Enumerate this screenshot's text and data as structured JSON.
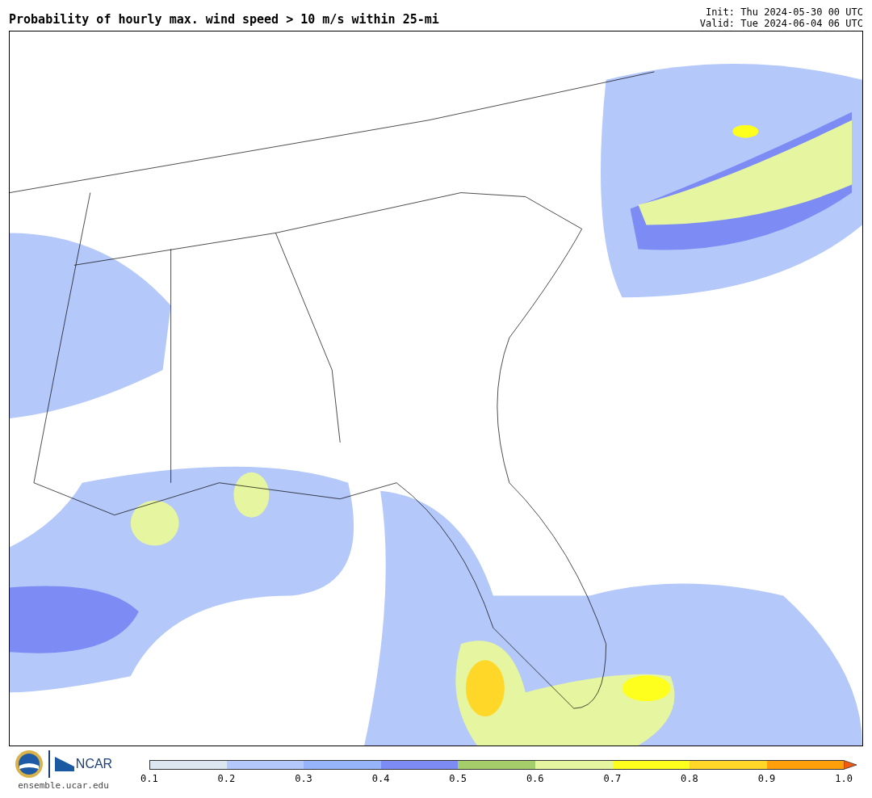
{
  "title": "Probability of hourly max. wind speed > 10 m/s within 25-mi",
  "init": "Init: Thu 2024-05-30 00 UTC",
  "valid": "Valid: Tue 2024-06-04 06 UTC",
  "logo": {
    "text": "NCAR"
  },
  "site": "ensemble.ucar.edu",
  "colorbar": {
    "segments": [
      {
        "color": "#dce6f0"
      },
      {
        "color": "#b4c8fa"
      },
      {
        "color": "#96b4fa"
      },
      {
        "color": "#7d8cf5"
      },
      {
        "color": "#a5cd69"
      },
      {
        "color": "#e6f5a0"
      },
      {
        "color": "#ffff1e"
      },
      {
        "color": "#ffd728"
      },
      {
        "color": "#ffa00a"
      }
    ],
    "ticks": [
      "0.1",
      "0.2",
      "0.3",
      "0.4",
      "0.5",
      "0.6",
      "0.7",
      "0.8",
      "0.9",
      "1.0"
    ]
  }
}
